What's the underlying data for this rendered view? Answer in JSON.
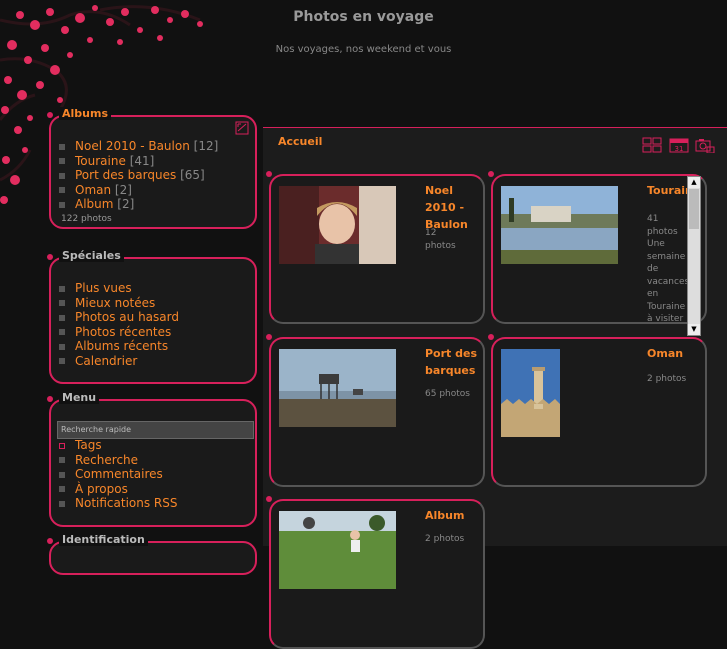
{
  "site": {
    "title": "Photos en voyage",
    "subtitle": "Nos voyages, nos weekend et vous"
  },
  "albums_box": {
    "title": "Albums",
    "items": [
      {
        "label": "Noel 2010 - Baulon",
        "count": "[12]"
      },
      {
        "label": "Touraine",
        "count": "[41]"
      },
      {
        "label": "Port des barques",
        "count": "[65]"
      },
      {
        "label": "Oman",
        "count": "[2]"
      },
      {
        "label": "Album",
        "count": "[2]"
      }
    ],
    "total": "122 photos"
  },
  "specials_box": {
    "title": "Spéciales",
    "items": [
      "Plus vues",
      "Mieux notées",
      "Photos au hasard",
      "Photos récentes",
      "Albums récents",
      "Calendrier"
    ]
  },
  "menu_box": {
    "title": "Menu",
    "search_value": "Recherche rapide",
    "items": [
      "Tags",
      "Recherche",
      "Commentaires",
      "À propos",
      "Notifications RSS"
    ]
  },
  "ident_box": {
    "title": "Identification"
  },
  "main": {
    "title": "Accueil"
  },
  "cards": [
    {
      "title": "Noel 2010 - Baulon",
      "info": "12 photos"
    },
    {
      "title": "Touraine",
      "info": "41 photos Une semaine de vacances en Touraine à visiter"
    },
    {
      "title": "Port des barques",
      "info": "65 photos"
    },
    {
      "title": "Oman",
      "info": "2 photos"
    },
    {
      "title": "Album",
      "info": "2 photos"
    }
  ],
  "colors": {
    "accent": "#d7205b",
    "link": "#f7862a",
    "background": "#111111"
  }
}
